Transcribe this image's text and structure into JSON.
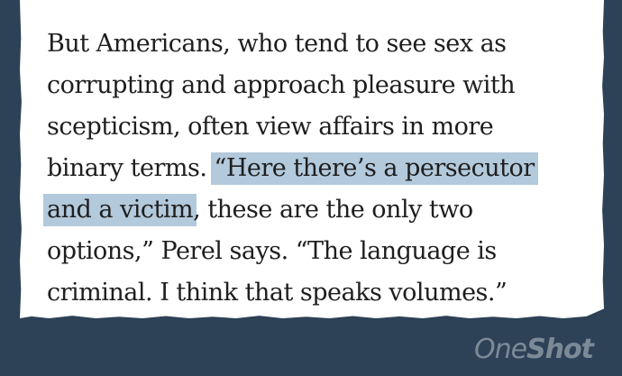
{
  "excerpt": {
    "line1": "But Americans, who tend to see sex as",
    "line2": "corrupting and approach pleasure with",
    "line3": "scepticism, often view affairs in more",
    "line4_plain": "binary terms. ",
    "line4_highlight": "“Here there’s a persecutor",
    "line5_highlight": "and a victim",
    "line5_plain": ", these are the only two",
    "line6": "options,” Perel says. “The language is",
    "line7": "criminal. I think that speaks volumes.”"
  },
  "watermark": {
    "part1": "One",
    "part2": "Shot"
  },
  "colors": {
    "background": "#2d4157",
    "paper": "#ffffff",
    "highlight": "#b3c9dc",
    "text": "#1e1e1e"
  }
}
